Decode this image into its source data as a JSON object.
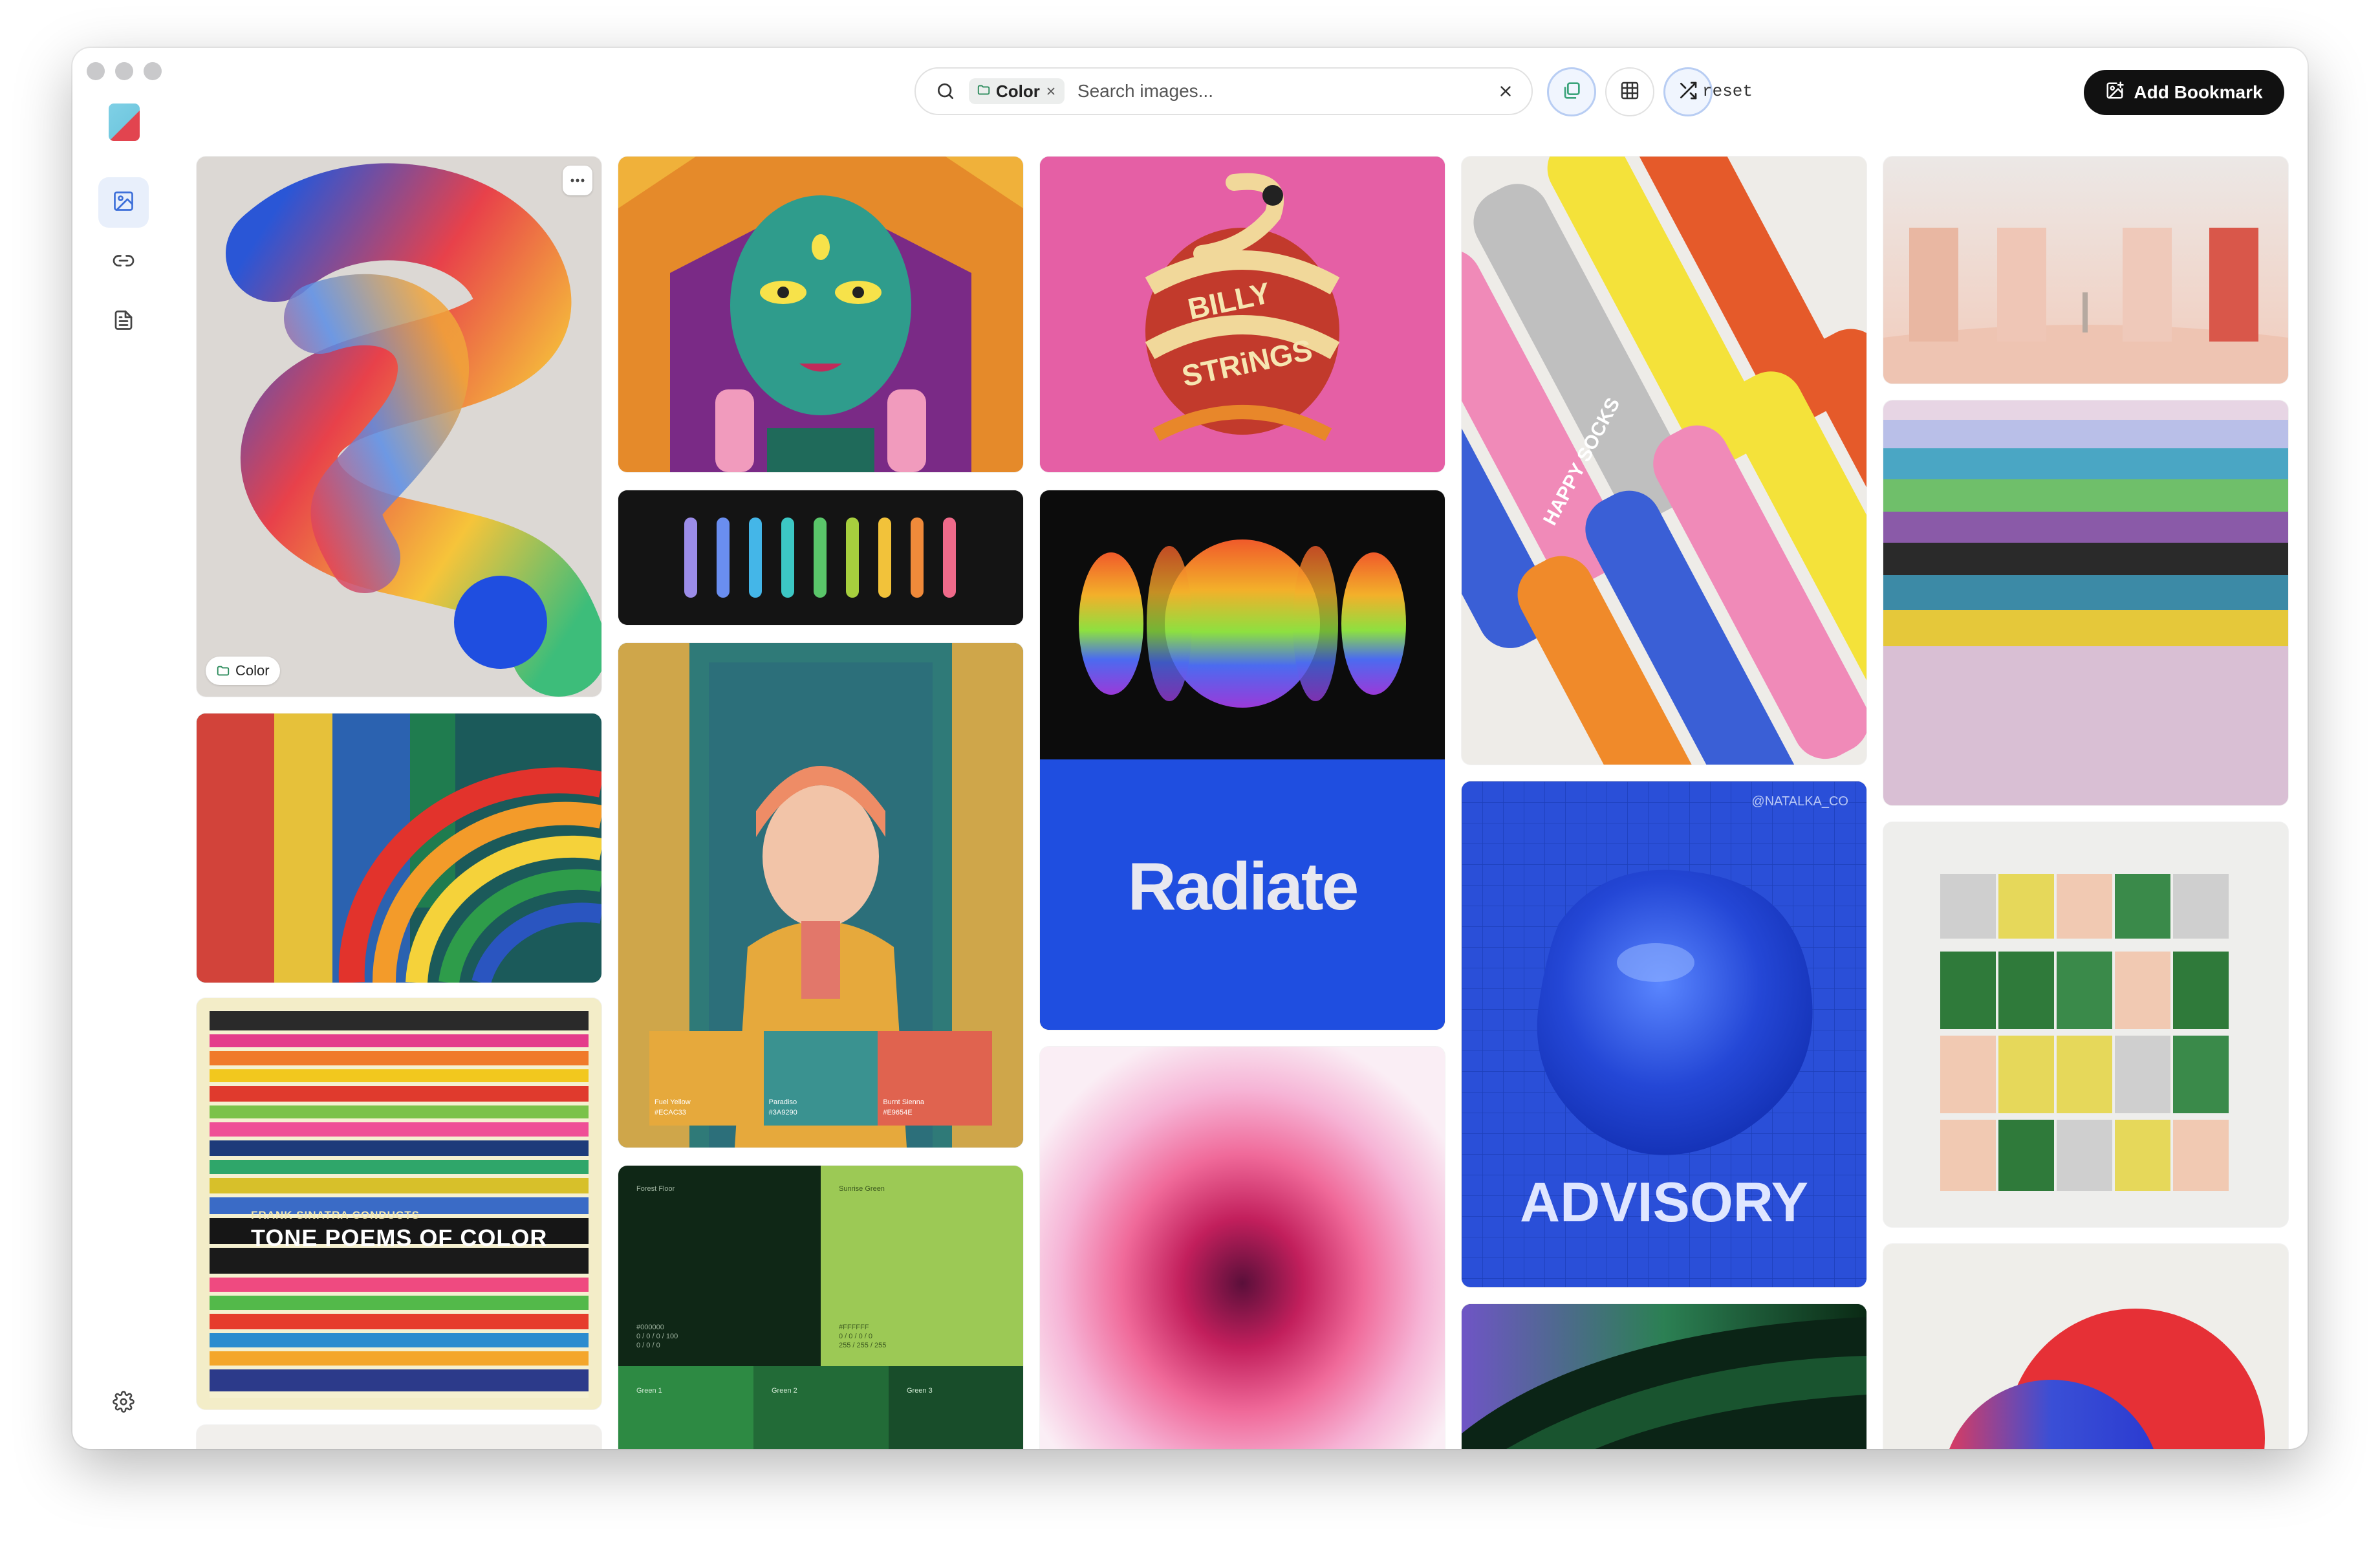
{
  "window": {
    "controls": [
      "close",
      "minimize",
      "zoom"
    ]
  },
  "sidebar": {
    "items": [
      {
        "name": "images",
        "icon": "image-icon",
        "active": true
      },
      {
        "name": "links",
        "icon": "link-icon",
        "active": false
      },
      {
        "name": "notes",
        "icon": "document-icon",
        "active": false
      }
    ],
    "settings_icon": "gear-icon"
  },
  "search": {
    "chip_label": "Color",
    "placeholder": "Search images..."
  },
  "toolbar": {
    "reset_label": "reset",
    "add_bookmark_label": "Add Bookmark"
  },
  "cards": {
    "first": {
      "tag_label": "Color"
    },
    "sinatra": {
      "line1": "FRANK SINATRA CONDUCTS",
      "line2": "TONE POEMS OF COLOR"
    },
    "billy": {
      "line1": "BILLY",
      "line2": "STRiNGS"
    },
    "palette": {
      "swatches": [
        {
          "name": "Fuel Yellow",
          "hex": "#ECAC33",
          "color": "#e6a93c"
        },
        {
          "name": "Paradiso",
          "hex": "#3A9290",
          "color": "#3a9290"
        },
        {
          "name": "Burnt Sienna",
          "hex": "#E9654E",
          "color": "#e0634f"
        }
      ]
    },
    "radiate": {
      "title": "Radiate"
    },
    "greens": {
      "forest_label": "Forest Floor",
      "sunrise_label": "Sunrise Green",
      "forest_hex": "#000000",
      "forest_rgb": "0 / 0 / 0 / 100",
      "forest_cmyk": "0 / 0 / 0",
      "sunrise_hex": "#FFFFFF",
      "sunrise_rgb": "0 / 0 / 0 / 0",
      "sunrise_cmyk": "255 / 255 / 255",
      "green1": "Green 1",
      "green2": "Green 2",
      "green3": "Green 3"
    },
    "socks": {
      "brand": "HAPPY SOCKS"
    },
    "advisory": {
      "handle": "@NATALKA_CO",
      "title": "ADVISORY"
    }
  },
  "colors": {
    "accent": "#3d6fd9",
    "button_dark": "#111111",
    "active_bg": "#e8effb"
  }
}
